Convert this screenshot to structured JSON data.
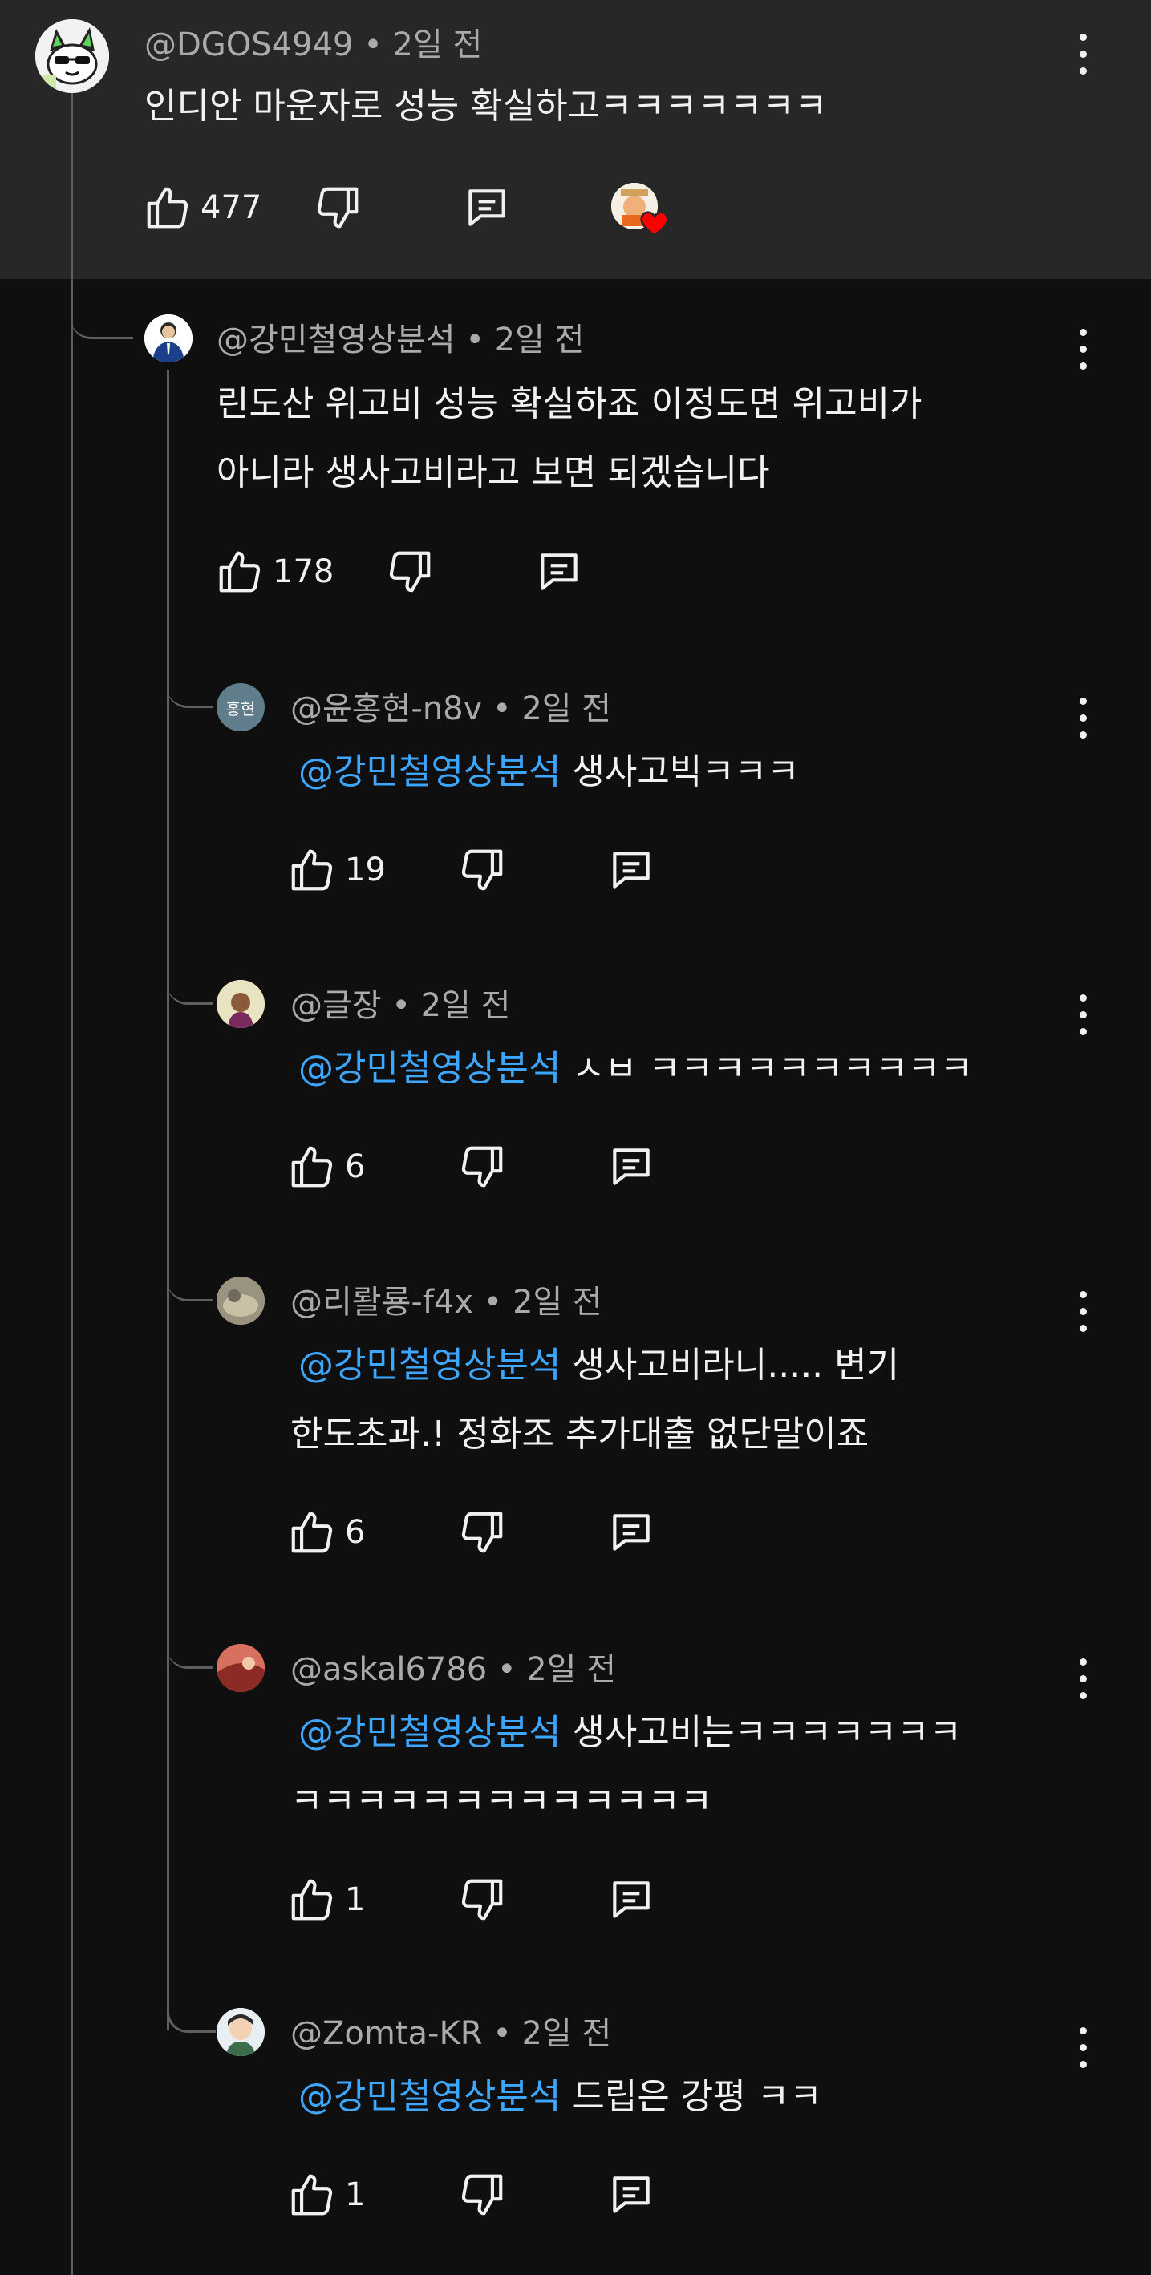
{
  "thread": {
    "parent": {
      "handle": "@DGOS4949",
      "time": "2일 전",
      "text": "인디안 마운자로 성능 확실하고ㅋㅋㅋㅋㅋㅋㅋ",
      "likes": "477"
    },
    "reply1": {
      "handle": "@강민철영상분석",
      "time": "2일 전",
      "line1": "린도산 위고비 성능 확실하죠 이정도면 위고비가",
      "line2": "아니라 생사고비라고 보면 되겠습니다",
      "likes": "178"
    },
    "replies": [
      {
        "handle": "@윤홍현-n8v",
        "time": "2일 전",
        "avatar_text": "홍현",
        "mention": "@강민철영상분석",
        "line1": " 생사고빅ㅋㅋㅋ",
        "line2": "",
        "likes": "19"
      },
      {
        "handle": "@글장",
        "time": "2일 전",
        "mention": "@강민철영상분석",
        "line1": " ㅅㅂ ㅋㅋㅋㅋㅋㅋㅋㅋㅋㅋ",
        "line2": "",
        "likes": "6"
      },
      {
        "handle": "@리뢀룡-f4x",
        "time": "2일 전",
        "mention": "@강민철영상분석",
        "line1": " 생사고비라니..... 변기",
        "line2": "한도초과.! 정화조 추가대출 없단말이죠",
        "likes": "6"
      },
      {
        "handle": "@askal6786",
        "time": "2일 전",
        "mention": "@강민철영상분석",
        "line1": " 생사고비는ㅋㅋㅋㅋㅋㅋㅋ",
        "line2": "ㅋㅋㅋㅋㅋㅋㅋㅋㅋㅋㅋㅋㅋ",
        "likes": "1"
      },
      {
        "handle": "@Zomta-KR",
        "time": "2일 전",
        "mention": "@강민철영상분석",
        "line1": " 드립은 강평 ㅋㅋ",
        "line2": "",
        "likes": "1"
      }
    ]
  },
  "icons": {
    "like": "thumbs-up-icon",
    "dislike": "thumbs-down-icon",
    "reply": "reply-icon",
    "more": "more-vert-icon",
    "heart": "creator-heart-icon"
  },
  "colors": {
    "mention": "#3ea6ff",
    "heart": "#ff0000",
    "highlight_bg": "#272727",
    "bg": "#0f0f0f"
  }
}
